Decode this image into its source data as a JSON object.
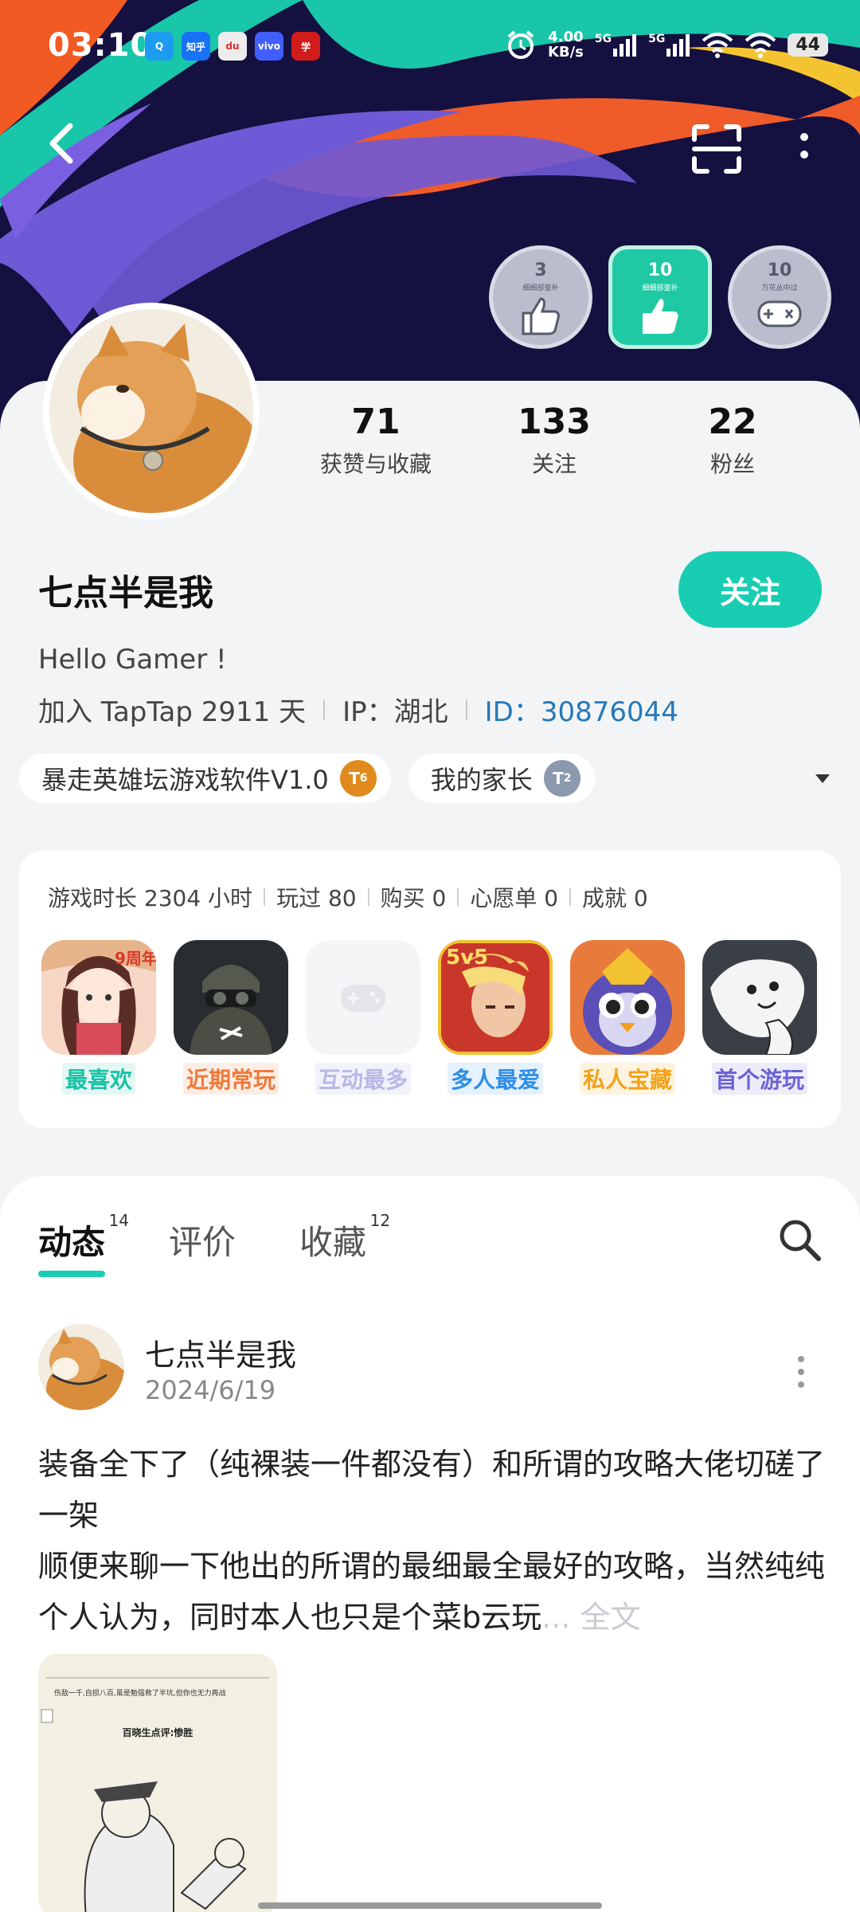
{
  "status_bar": {
    "time": "03:10",
    "apps": [
      {
        "name": "qq-icon",
        "text": "Q",
        "color": "#1d9bf0"
      },
      {
        "name": "zhihu-icon",
        "text": "知乎",
        "color": "#1772f6"
      },
      {
        "name": "map-icon",
        "text": "du",
        "color": "#e8e8e8"
      },
      {
        "name": "vivo-icon",
        "text": "vivo",
        "color": "#415fff"
      },
      {
        "name": "study-icon",
        "text": "学",
        "color": "#d21b1b"
      }
    ],
    "net_speed": "4.00",
    "net_unit": "KB/s",
    "signal_label_1": "5G",
    "signal_label_2": "5G",
    "battery": "44"
  },
  "badges": [
    {
      "count": "3",
      "caption": "细细部鉴补",
      "icon": "thumbs-up-icon",
      "style": "grey"
    },
    {
      "count": "10",
      "caption": "细细部鉴补",
      "icon": "thumbs-up-icon",
      "style": "green"
    },
    {
      "count": "10",
      "caption": "万花丛中过",
      "icon": "gamepad-icon",
      "style": "grey"
    }
  ],
  "profile": {
    "stats": [
      {
        "value": "71",
        "label": "获赞与收藏"
      },
      {
        "value": "133",
        "label": "关注"
      },
      {
        "value": "22",
        "label": "粉丝"
      }
    ],
    "username": "七点半是我",
    "follow_label": "关注",
    "bio": "Hello Gamer !",
    "joined": "加入 TapTap 2911 天",
    "ip": "IP：湖北",
    "id_label": "ID：",
    "id_value": "30876044",
    "tags": [
      {
        "label": "暴走英雄坛游戏软件V1.0",
        "level": "6",
        "color": "#e08a1e"
      },
      {
        "label": "我的家长",
        "level": "2",
        "color": "#8c98ad"
      }
    ]
  },
  "games": {
    "stats": [
      "游戏时长 2304 小时",
      "玩过 80",
      "购买 0",
      "心愿单 0",
      "成就 0"
    ],
    "items": [
      {
        "label": "最喜欢",
        "color": "#19c2a6",
        "bg": "#e3f8f3",
        "badge": "9周年"
      },
      {
        "label": "近期常玩",
        "color": "#f0793a",
        "bg": "#fdeee5",
        "badge": ""
      },
      {
        "label": "互动最多",
        "color": "#b7b8e8",
        "bg": "#f2f2fb",
        "badge": ""
      },
      {
        "label": "多人最爱",
        "color": "#2f8ee8",
        "bg": "#e5f1fd",
        "badge": "5v5"
      },
      {
        "label": "私人宝藏",
        "color": "#f2a21a",
        "bg": "#fdf3df",
        "badge": ""
      },
      {
        "label": "首个游玩",
        "color": "#6b63d6",
        "bg": "#eeecfb",
        "badge": ""
      }
    ]
  },
  "feed": {
    "tabs": [
      {
        "label": "动态",
        "count": "14",
        "active": true
      },
      {
        "label": "评价",
        "count": "",
        "active": false
      },
      {
        "label": "收藏",
        "count": "12",
        "active": false
      }
    ],
    "post": {
      "author": "七点半是我",
      "date": "2024/6/19",
      "text_line1": "装备全下了（纯裸装一件都没有）和所谓的攻略大佬切磋了一架",
      "text_line2": "顺便来聊一下他出的所谓的最细最全最好的攻略，当然纯纯个人认为，同时本人也只是个菜b云玩",
      "more_label": "... 全文",
      "image_caption_top": "伤敌一千,自损八百,虽是勉强救了半坑,但你也无力再战",
      "image_caption_title": "百晓生点评:惨胜"
    }
  },
  "colors": {
    "accent": "#19cdb2",
    "banner_bg": "#14103f",
    "id_link": "#2479b8"
  }
}
